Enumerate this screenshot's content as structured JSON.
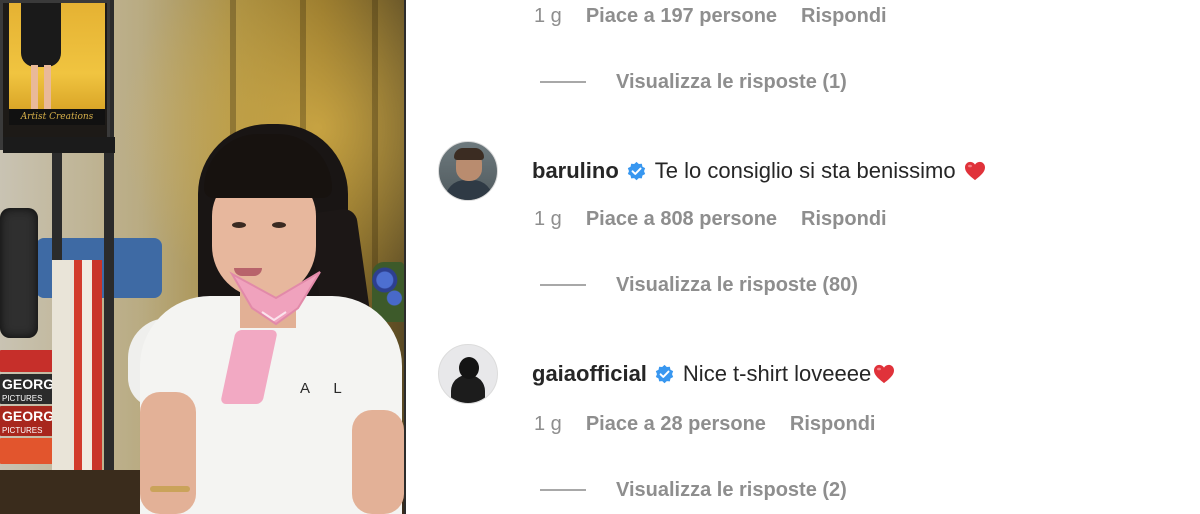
{
  "photo": {
    "frame_sign": "Artist Creations",
    "books": [
      {
        "title": "GEORGE",
        "sub": "PICTURES",
        "color": "#2b2b2b"
      },
      {
        "title": "GEORGE",
        "sub": "PICTURES",
        "color": "#a8271d"
      }
    ],
    "shirt_text": "A L"
  },
  "comments": {
    "top_meta": {
      "time": "1 g",
      "likes": "Piace a 197 persone",
      "reply": "Rispondi"
    },
    "top_replies": "Visualizza le risposte (1)",
    "items": [
      {
        "username": "barulino",
        "verified": true,
        "text": "Te lo consiglio si sta benissimo",
        "emoji": "heart-icon",
        "time": "1 g",
        "likes": "Piace a 808 persone",
        "reply": "Rispondi",
        "replies": "Visualizza le risposte (80)"
      },
      {
        "username": "gaiaofficial",
        "verified": true,
        "text": "Nice t-shirt loveeee",
        "emoji": "heart-icon",
        "time": "1 g",
        "likes": "Piace a 28 persone",
        "reply": "Rispondi",
        "replies": "Visualizza le risposte (2)"
      }
    ]
  },
  "colors": {
    "verified": "#3897f0",
    "heart": "#e0323a",
    "meta_text": "#8e8e8e",
    "primary_text": "#262626"
  }
}
